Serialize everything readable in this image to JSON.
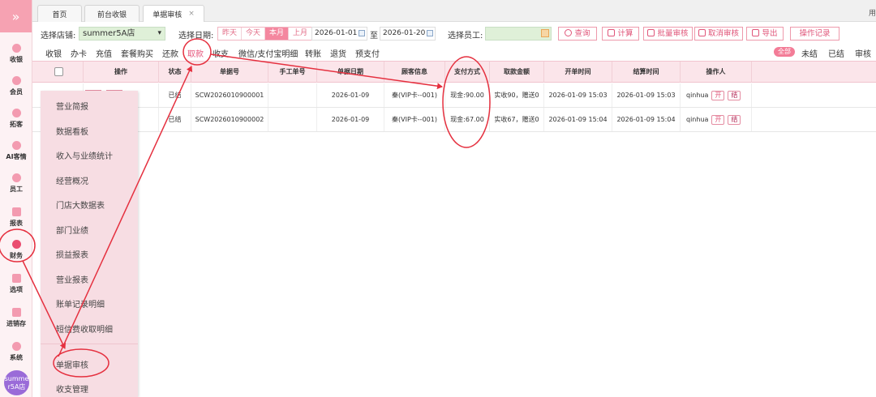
{
  "rail": {
    "toggle_glyph": "»",
    "items": [
      {
        "label": "收银",
        "icon": "cashier-icon"
      },
      {
        "label": "会员",
        "icon": "member-icon"
      },
      {
        "label": "拓客",
        "icon": "customer-icon"
      },
      {
        "label": "AI客情",
        "icon": "ai-icon"
      },
      {
        "label": "员工",
        "icon": "staff-icon"
      },
      {
        "label": "报表",
        "icon": "report-icon"
      },
      {
        "label": "财务",
        "icon": "finance-icon"
      },
      {
        "label": "选项",
        "icon": "options-icon"
      },
      {
        "label": "进销存",
        "icon": "inventory-icon"
      },
      {
        "label": "系统",
        "icon": "system-icon"
      }
    ],
    "avatar_line1": "summe",
    "avatar_line2": "r5A店"
  },
  "tabs": [
    {
      "label": "首页"
    },
    {
      "label": "前台收银"
    },
    {
      "label": "单据审核",
      "close": "×"
    }
  ],
  "tab_edge_text": "用",
  "filters": {
    "store_label": "选择店铺:",
    "store_value": "summer5A店",
    "date_label": "选择日期:",
    "quick_dates": [
      "昨天",
      "今天",
      "本月",
      "上月"
    ],
    "active_quick_date": "本月",
    "date_from": "2026-01-01",
    "date_sep": "至",
    "date_to": "2026-01-20",
    "employee_label": "选择员工:",
    "employee_value": "",
    "buttons": {
      "query": "查询",
      "calc": "计算",
      "batch_audit": "批量审核",
      "cancel_audit": "取消审核",
      "export": "导出",
      "op_log": "操作记录"
    }
  },
  "subtabs": [
    "收银",
    "办卡",
    "充值",
    "套餐购买",
    "还款",
    "取款",
    "收支",
    "微信/支付宝明细",
    "转账",
    "退货",
    "预支付"
  ],
  "active_subtab": "取款",
  "status_filters": [
    "全部",
    "未结",
    "已结",
    "审核"
  ],
  "table": {
    "headers": [
      "操作",
      "状态",
      "单据号",
      "手工单号",
      "单据日期",
      "顾客信息",
      "支付方式",
      "取款金额",
      "开单时间",
      "结算时间",
      "操作人"
    ],
    "rows": [
      {
        "status": "已结",
        "doc_no": "SCW2026010900001",
        "manual_no": "",
        "date": "2026-01-09",
        "customer": "秦(VIP卡--001)",
        "payment": "现金:90.00",
        "amount": "实收90，赠送0",
        "open_time": "2026-01-09 15:03",
        "settle_time": "2026-01-09 15:03",
        "operator": "qinhua",
        "op_tag1": "开",
        "op_tag2": "结"
      },
      {
        "status": "已结",
        "doc_no": "SCW2026010900002",
        "manual_no": "",
        "date": "2026-01-09",
        "customer": "秦(VIP卡--001)",
        "payment": "现金:67.00",
        "amount": "实收67，赠送0",
        "open_time": "2026-01-09 15:04",
        "settle_time": "2026-01-09 15:04",
        "operator": "qinhua",
        "op_tag1": "开",
        "op_tag2": "结"
      }
    ]
  },
  "menu": {
    "items": [
      "营业简报",
      "数据看板",
      "收入与业绩统计",
      "经营概况",
      "门店大数据表",
      "部门业绩",
      "损益报表",
      "营业报表",
      "账单记录明细",
      "短信费收取明细",
      "单据审核",
      "收支管理"
    ],
    "active": "单据审核"
  },
  "colors": {
    "accent": "#e6587d",
    "annotation_red": "#e5303f",
    "menu_bg": "#f7dde3",
    "table_head_bg": "#fbe5ea"
  }
}
